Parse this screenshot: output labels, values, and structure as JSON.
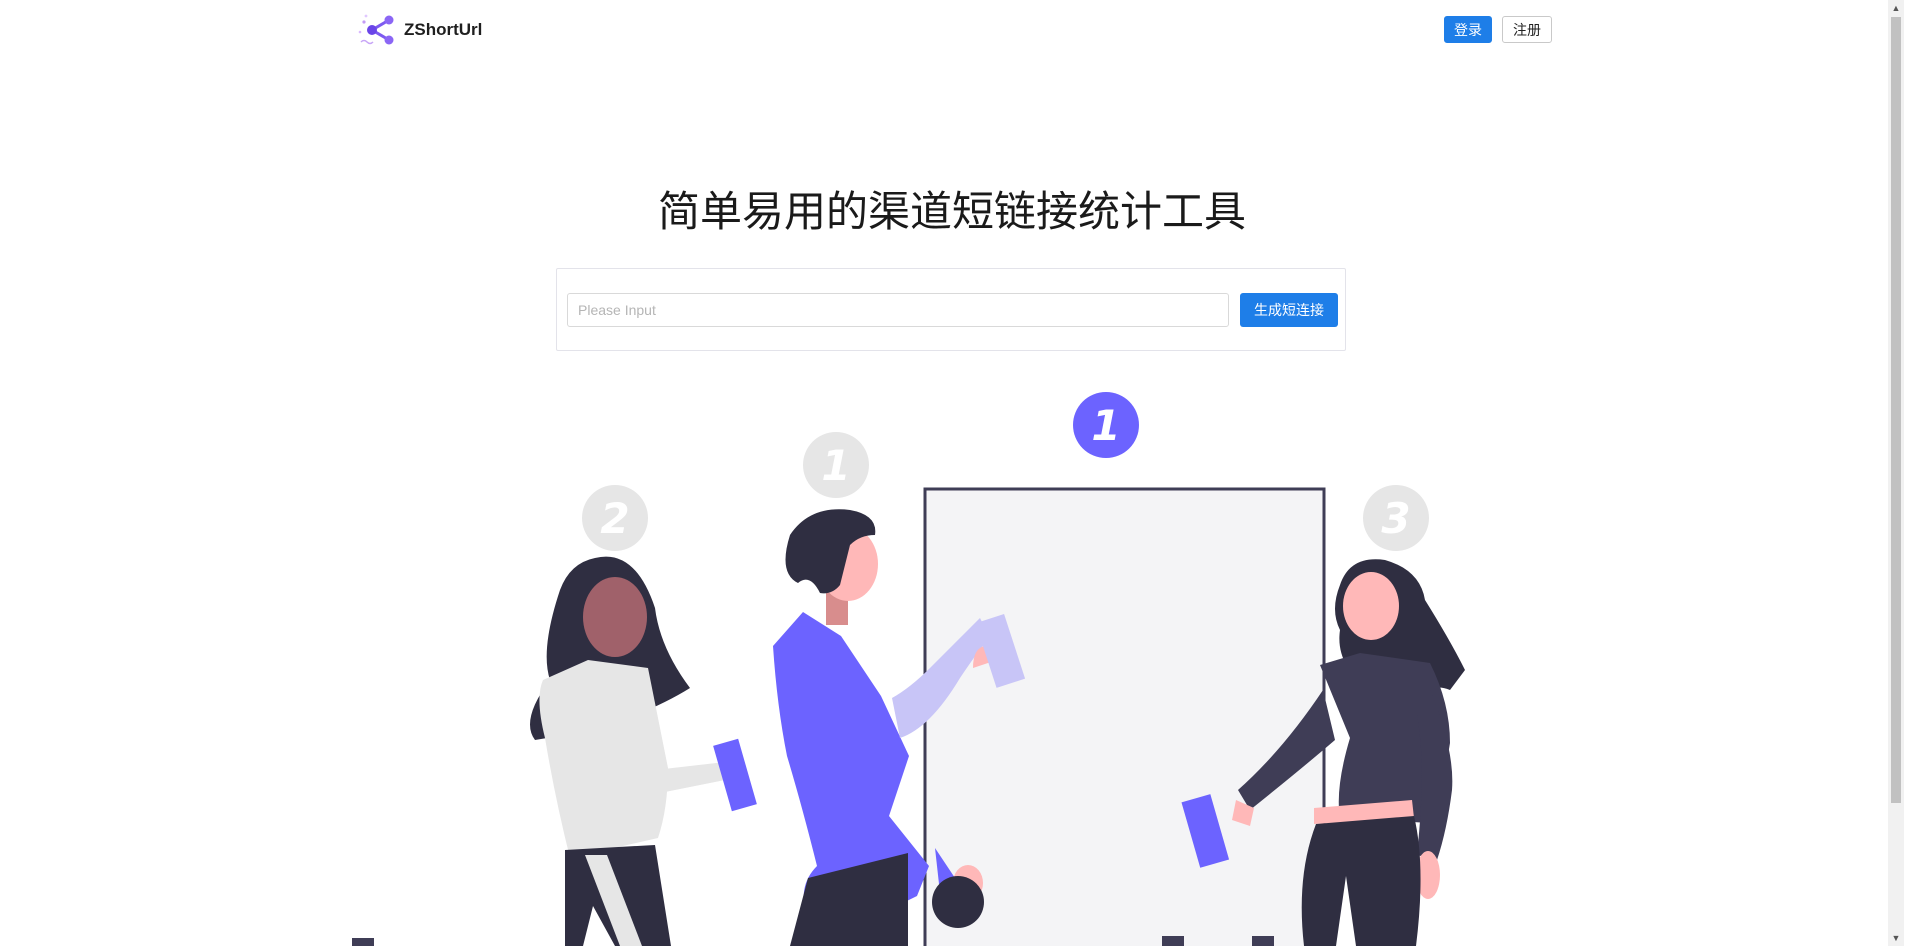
{
  "app": {
    "brand_name": "ZShortUrl",
    "logo_icon": "share-nodes-icon"
  },
  "header": {
    "login_label": "登录",
    "register_label": "注册"
  },
  "hero": {
    "title": "简单易用的渠道短链接统计工具",
    "input_placeholder": "Please Input",
    "input_value": "",
    "generate_label": "生成短连接"
  },
  "illustration": {
    "badges": [
      "2",
      "1",
      "1",
      "3"
    ],
    "colors": {
      "accent": "#6c63ff",
      "badge_gray": "#e6e6e6",
      "dark": "#2f2e41",
      "skin": "#ffb8b8",
      "door_fill": "#f2f2f2"
    }
  },
  "scrollbar": {
    "up_icon": "triangle-up-icon",
    "down_icon": "triangle-down-icon"
  }
}
